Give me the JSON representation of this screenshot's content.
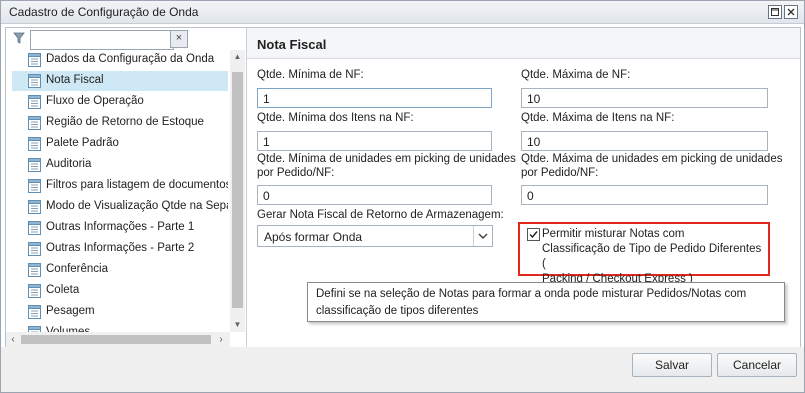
{
  "window": {
    "title": "Cadastro de Configuração de Onda",
    "maximize_icon": "maximize-icon",
    "close_icon": "close-icon"
  },
  "filter": {
    "value": "",
    "clear_label": "×"
  },
  "tree": {
    "items": [
      {
        "label": "Dados da Configuração da Onda"
      },
      {
        "label": "Nota Fiscal"
      },
      {
        "label": "Fluxo de Operação"
      },
      {
        "label": "Região de Retorno de Estoque"
      },
      {
        "label": "Palete Padrão"
      },
      {
        "label": "Auditoria"
      },
      {
        "label": "Filtros para listagem de documentos"
      },
      {
        "label": "Modo de Visualização Qtde na Separação"
      },
      {
        "label": "Outras Informações - Parte 1"
      },
      {
        "label": "Outras Informações - Parte 2"
      },
      {
        "label": "Conferência"
      },
      {
        "label": "Coleta"
      },
      {
        "label": "Pesagem"
      },
      {
        "label": "Volumes"
      }
    ],
    "selected_index": 1
  },
  "section": {
    "title": "Nota Fiscal"
  },
  "form": {
    "min_nf_label": "Qtde. Mínima de NF:",
    "min_nf_value": "1",
    "max_nf_label": "Qtde. Máxima de NF:",
    "max_nf_value": "10",
    "min_itens_label": "Qtde. Mínima dos Itens na NF:",
    "min_itens_value": "1",
    "max_itens_label": "Qtde. Máxima de Itens na NF:",
    "max_itens_value": "10",
    "min_unid_label_1": "Qtde. Mínima de unidades em picking de unidades",
    "min_unid_label_2": "por Pedido/NF:",
    "min_unid_value": "0",
    "max_unid_label_1": "Qtde. Máxima de unidades em picking de unidades",
    "max_unid_label_2": "por Pedido/NF:",
    "max_unid_value": "0",
    "gerar_label": "Gerar Nota Fiscal de Retorno de Armazenagem:",
    "gerar_value": "Após formar Onda",
    "permitir_checked": true,
    "permitir_line1": "Permitir misturar Notas com",
    "permitir_line2": "Classificação de Tipo de Pedido Diferentes (",
    "permitir_line3": "Packing / Checkout Express )"
  },
  "tooltip": {
    "line1": "Defini se na seleção de Notas para formar a onda pode misturar Pedidos/Notas com",
    "line2": "classificação de tipos diferentes"
  },
  "buttons": {
    "save": "Salvar",
    "cancel": "Cancelar"
  },
  "colors": {
    "selected_row": "#cfe8f5",
    "highlight_border": "#e3271b"
  }
}
